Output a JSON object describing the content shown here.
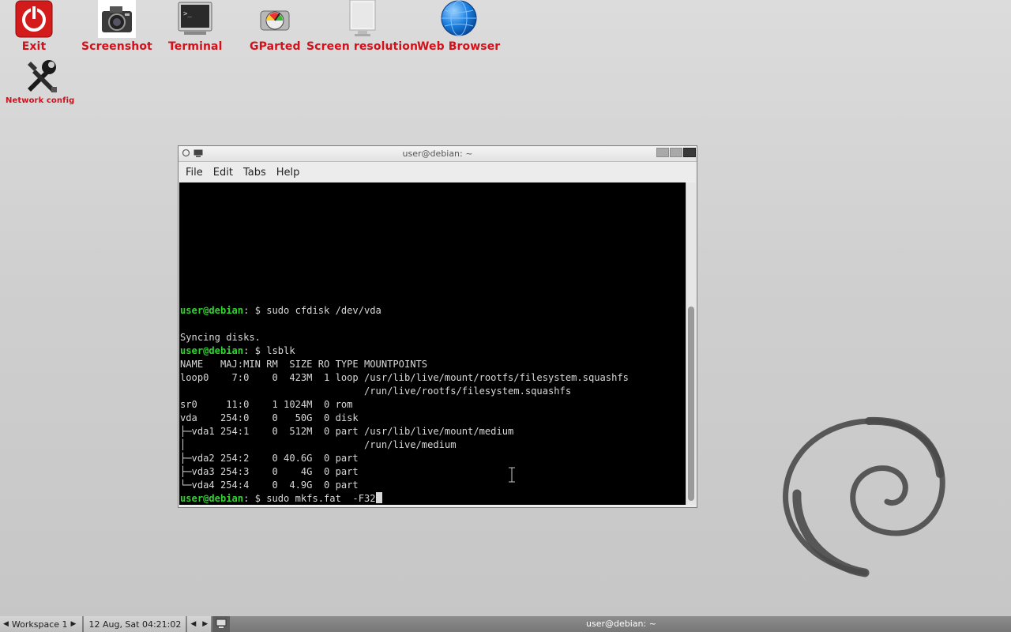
{
  "desktop": {
    "icons": [
      {
        "label": "Exit",
        "icon": "power-icon"
      },
      {
        "label": "Screenshot",
        "icon": "camera-icon"
      },
      {
        "label": "Terminal",
        "icon": "terminal-icon"
      },
      {
        "label": "GParted",
        "icon": "gparted-icon"
      },
      {
        "label": "Screen resolution",
        "icon": "monitor-icon"
      },
      {
        "label": "Web Browser",
        "icon": "globe-icon"
      },
      {
        "label": "Network config",
        "icon": "tools-icon"
      }
    ]
  },
  "window": {
    "title": "user@debian: ~",
    "menu": [
      "File",
      "Edit",
      "Tabs",
      "Help"
    ]
  },
  "terminal": {
    "prompt_user": "user@debian",
    "prompt_rest": ": $ ",
    "lines": [
      {
        "type": "prompt",
        "cmd": "sudo cfdisk /dev/vda"
      },
      {
        "type": "text",
        "text": ""
      },
      {
        "type": "text",
        "text": "Syncing disks."
      },
      {
        "type": "prompt",
        "cmd": "lsblk"
      },
      {
        "type": "text",
        "text": "NAME   MAJ:MIN RM  SIZE RO TYPE MOUNTPOINTS"
      },
      {
        "type": "text",
        "text": "loop0    7:0    0  423M  1 loop /usr/lib/live/mount/rootfs/filesystem.squashfs"
      },
      {
        "type": "text",
        "text": "                                /run/live/rootfs/filesystem.squashfs"
      },
      {
        "type": "text",
        "text": "sr0     11:0    1 1024M  0 rom"
      },
      {
        "type": "text",
        "text": "vda    254:0    0   50G  0 disk"
      },
      {
        "type": "text",
        "text": "├─vda1 254:1    0  512M  0 part /usr/lib/live/mount/medium"
      },
      {
        "type": "text",
        "text": "│                               /run/live/medium"
      },
      {
        "type": "text",
        "text": "├─vda2 254:2    0 40.6G  0 part"
      },
      {
        "type": "text",
        "text": "├─vda3 254:3    0    4G  0 part"
      },
      {
        "type": "text",
        "text": "└─vda4 254:4    0  4.9G  0 part"
      },
      {
        "type": "prompt",
        "cmd": "sudo mkfs.fat  -F32",
        "cursor": true
      }
    ]
  },
  "taskbar": {
    "workspace": "Workspace 1",
    "datetime": "12 Aug, Sat 04:21:02",
    "task_title": "user@debian: ~"
  },
  "colors": {
    "desktop_label": "#d4101a",
    "prompt_user": "#2fd22f",
    "terminal_bg": "#000000"
  }
}
